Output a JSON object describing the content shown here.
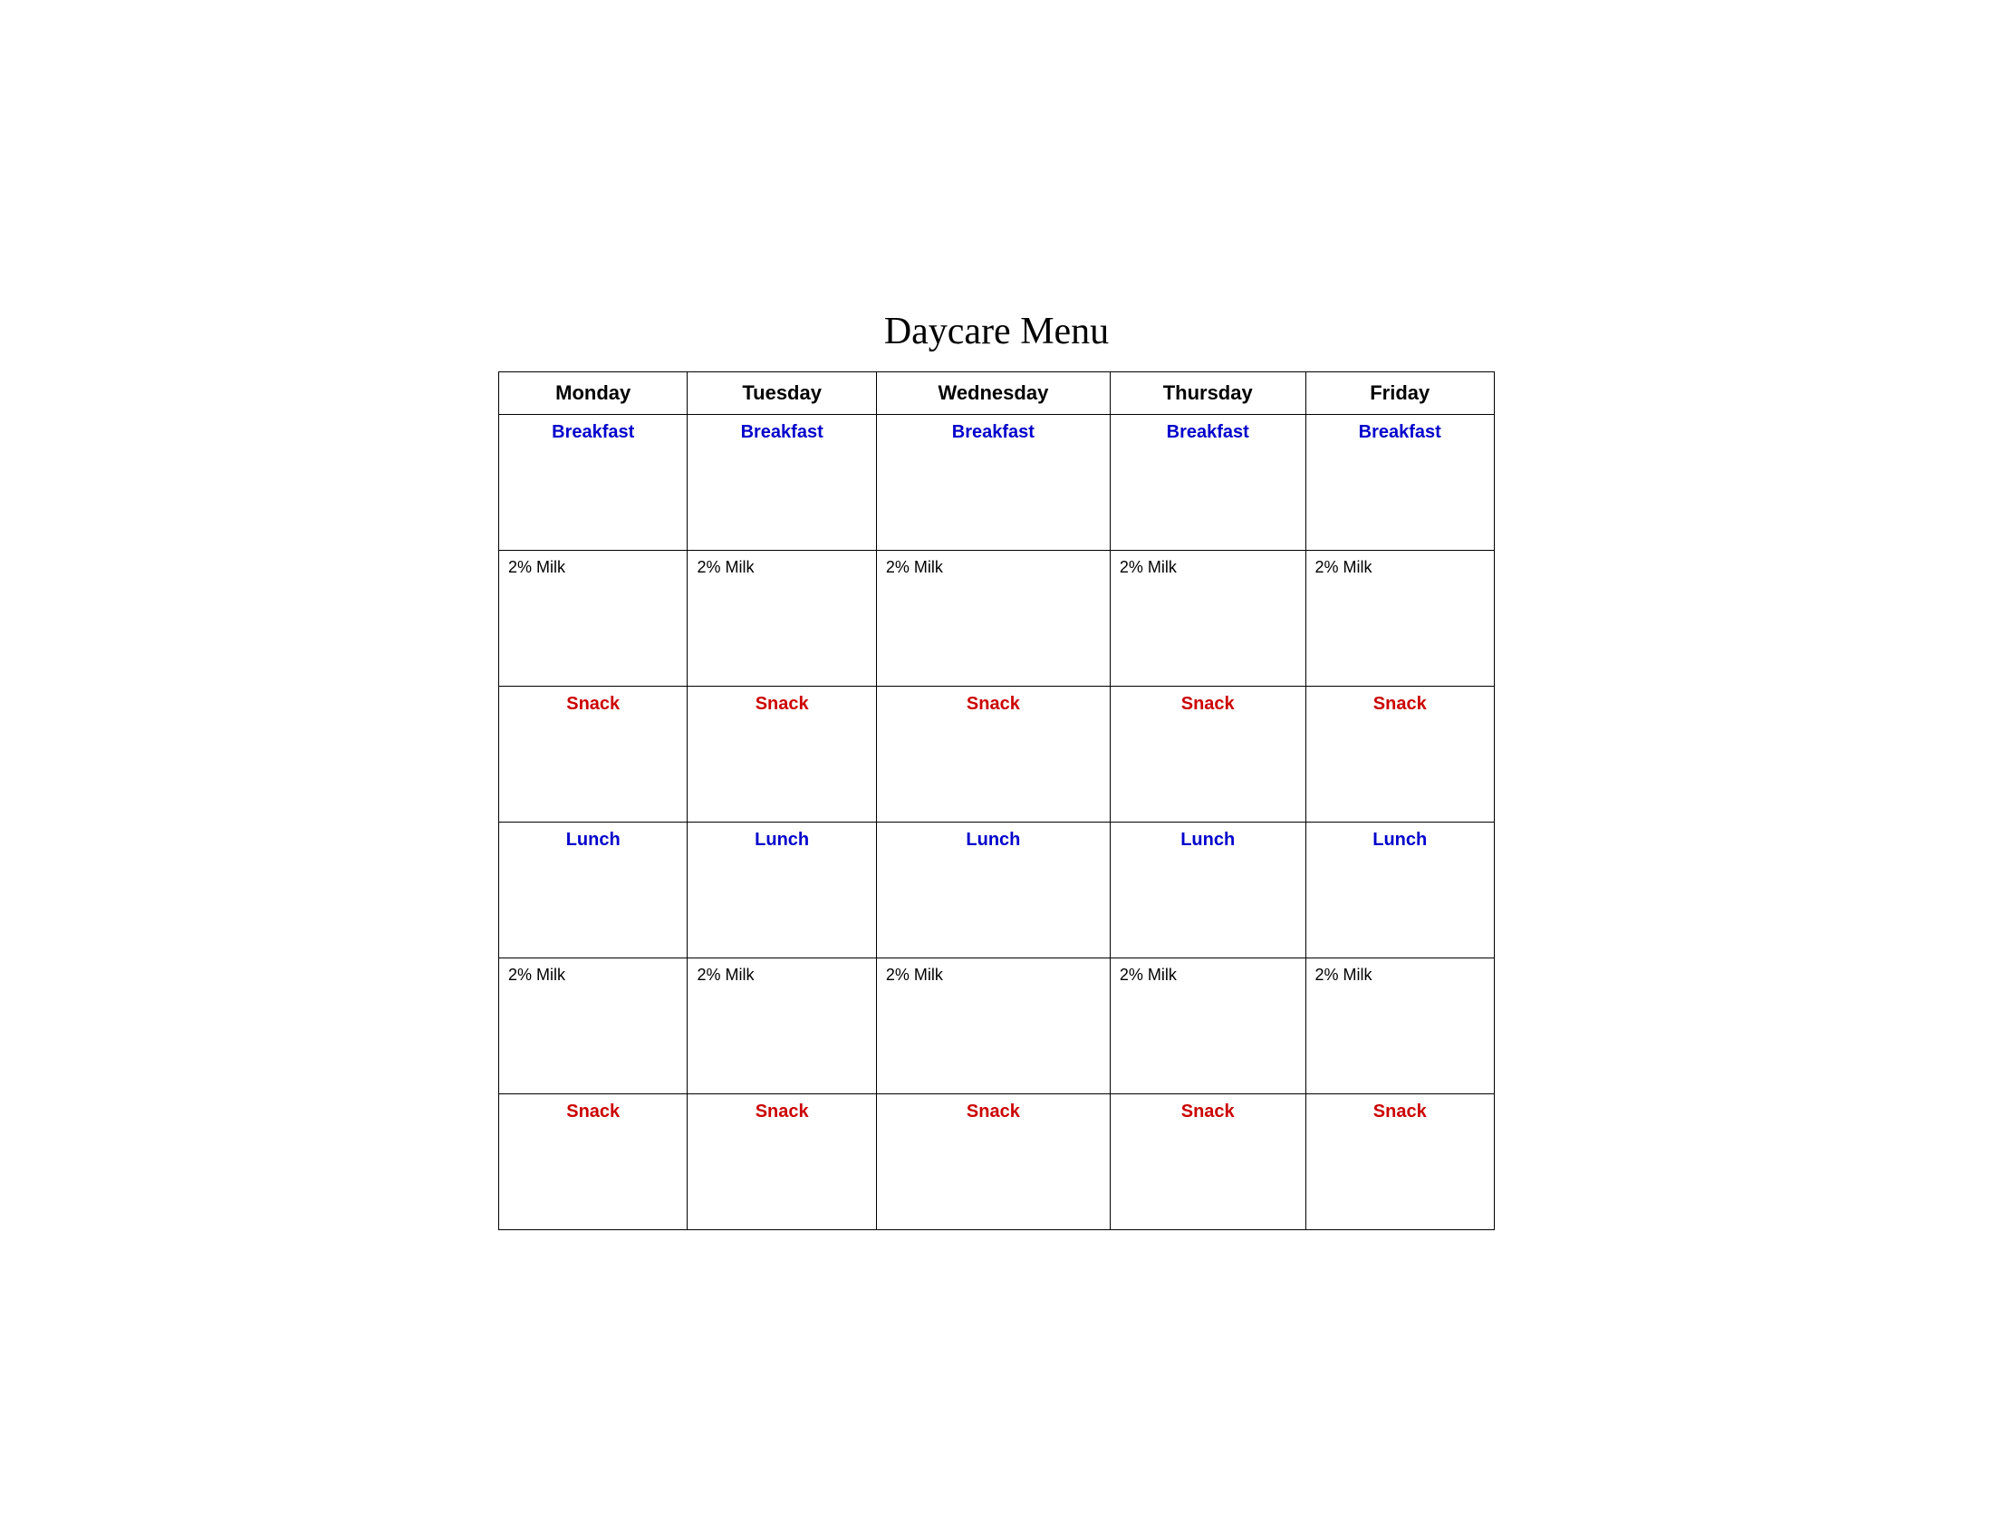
{
  "title": "Daycare Menu",
  "columns": [
    "Monday",
    "Tuesday",
    "Wednesday",
    "Thursday",
    "Friday"
  ],
  "rows": {
    "breakfast_label": "Breakfast",
    "milk1_label": "2% Milk",
    "snack1_label": "Snack",
    "lunch_label": "Lunch",
    "milk2_label": "2% Milk",
    "snack2_label": "Snack"
  },
  "colors": {
    "breakfast": "#0000cc",
    "lunch": "#0000cc",
    "snack": "#cc0000",
    "header": "#000000",
    "text": "#000000"
  }
}
